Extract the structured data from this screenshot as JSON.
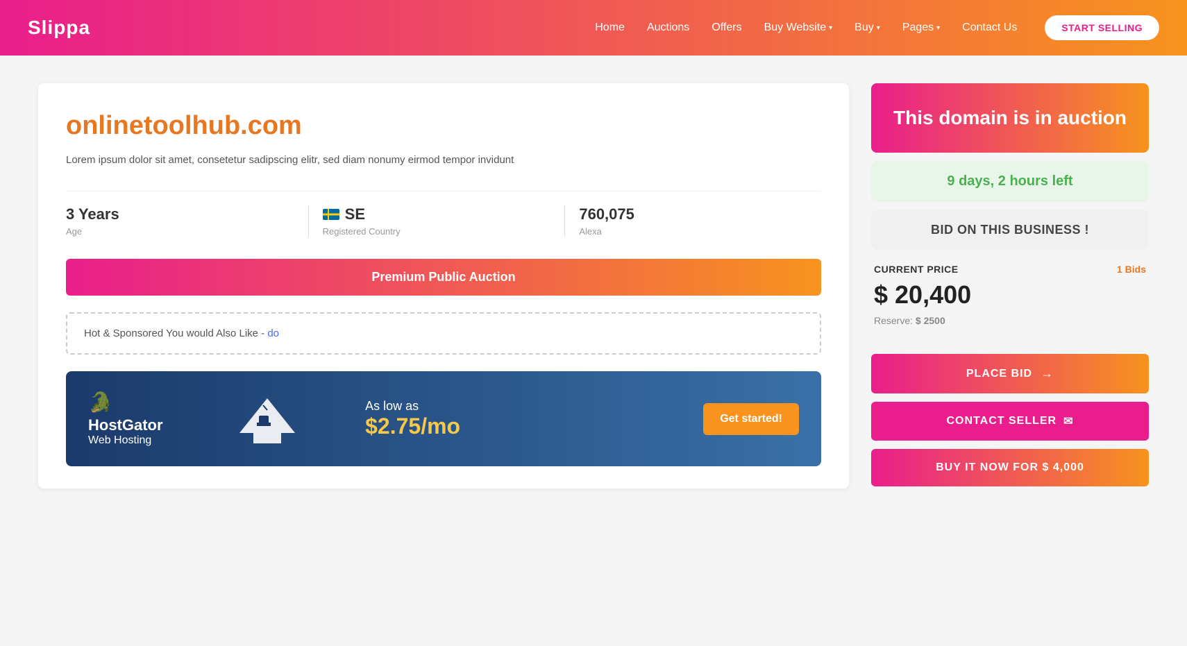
{
  "header": {
    "logo": "Slippa",
    "nav": [
      {
        "label": "Home",
        "hasDropdown": false
      },
      {
        "label": "Auctions",
        "hasDropdown": false
      },
      {
        "label": "Offers",
        "hasDropdown": false
      },
      {
        "label": "Buy Website",
        "hasDropdown": true
      },
      {
        "label": "Buy",
        "hasDropdown": true
      },
      {
        "label": "Pages",
        "hasDropdown": true
      },
      {
        "label": "Contact Us",
        "hasDropdown": false
      }
    ],
    "startSelling": "START SELLING"
  },
  "leftPanel": {
    "domainName": "onlinetoolhub.com",
    "description": "Lorem ipsum dolor sit amet, consetetur sadipscing elitr, sed diam nonumy eirmod tempor invidunt",
    "descriptionLinkText": "invidunt",
    "stats": [
      {
        "value": "3 Years",
        "label": "Age"
      },
      {
        "value": "SE",
        "label": "Registered Country",
        "hasFlag": true
      },
      {
        "value": "760,075",
        "label": "Alexa"
      }
    ],
    "auctionBanner": "Premium Public Auction",
    "sponsoredText": "Hot & Sponsored You would Also Like - do",
    "sponsoredLink": "do",
    "hostgator": {
      "brand": "HostGator",
      "sub": "Web Hosting",
      "asLow": "As low as",
      "price": "$2.75/mo",
      "btnLabel": "Get started!"
    }
  },
  "rightPanel": {
    "auctionHeader": "This domain is in auction",
    "timeLeft": "9 days, 2 hours left",
    "bidBusiness": "BID ON THIS BUSINESS !",
    "currentPriceLabel": "CURRENT PRICE",
    "bidsCount": "1 Bids",
    "priceValue": "$ 20,400",
    "reserveLabel": "Reserve:",
    "reserveAmount": "$ 2500",
    "placeBidLabel": "PLACE BID",
    "contactSellerLabel": "CONTACT SELLER",
    "buyNowLabel": "BUY IT NOW FOR $ 4,000"
  }
}
